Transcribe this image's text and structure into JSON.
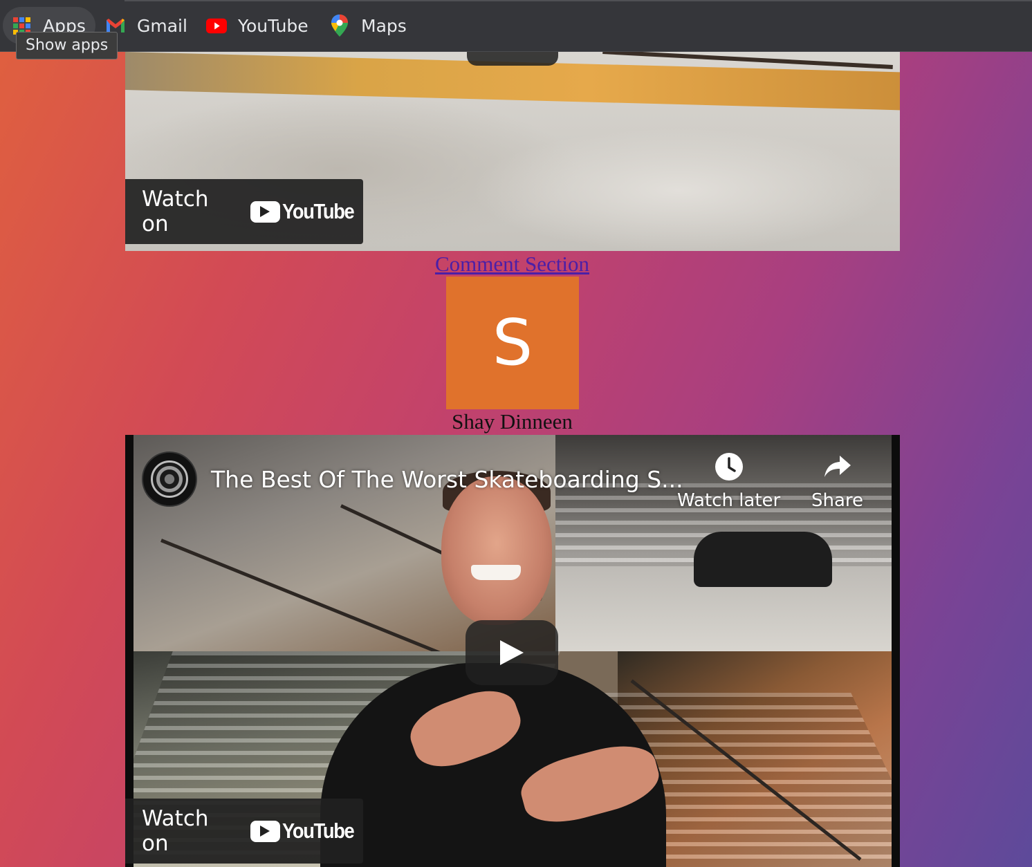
{
  "bookmarks": [
    {
      "label": "Apps",
      "icon": "apps-grid-icon"
    },
    {
      "label": "Gmail",
      "icon": "gmail-icon"
    },
    {
      "label": "YouTube",
      "icon": "youtube-icon"
    },
    {
      "label": "Maps",
      "icon": "maps-pin-icon"
    }
  ],
  "tooltip": "Show apps",
  "video_top": {
    "watch_label": "Watch on",
    "brand": "YouTube"
  },
  "comments": {
    "link_label": "Comment Section",
    "avatar_letter": "S",
    "author": "Shay Dinneen"
  },
  "video_bottom": {
    "title": "The Best Of The Worst Skateboarding S...",
    "watch_later_label": "Watch later",
    "share_label": "Share",
    "watch_label": "Watch on",
    "brand": "YouTube"
  },
  "colors": {
    "avatar_bg": "#e0722c",
    "link": "#4b1fa7",
    "youtube_red": "#ff0000"
  }
}
